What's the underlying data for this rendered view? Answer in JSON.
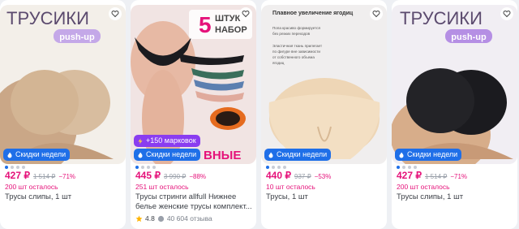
{
  "products": [
    {
      "title_overlay": "ТРУСИКИ",
      "pill": "push-up",
      "badge": "Скидки недели",
      "price": "427 ₽",
      "old_price": "1 514 ₽",
      "discount": "−71%",
      "stock": "200 шт осталось",
      "name": "Трусы слипы, 1 шт"
    },
    {
      "promo_number": "5",
      "promo_word1": "ШТУК",
      "promo_word2": "НАБОР",
      "bottom_text": "ВНЫЕ",
      "carrot_badge": "+150 марковок",
      "badge": "Скидки недели",
      "price": "445 ₽",
      "old_price": "3 990 ₽",
      "discount": "−88%",
      "stock": "251 шт осталось",
      "name": "Трусы стринги allfull Нижнее белье женские трусы комплект...",
      "rating": "4.8",
      "reviews": "40 604 отзыва"
    },
    {
      "heading": "Плавное увеличение ягодиц",
      "line1a": "Попа красиво формируется",
      "line1b": "без резких переходов",
      "line2a": "Эластичная ткань прилегает",
      "line2b": "по фигуре вне зависимости",
      "line2c": "от собственного объема",
      "line2d": "ягодиц",
      "badge": "Скидки недели",
      "price": "440 ₽",
      "old_price": "937 ₽",
      "discount": "−53%",
      "stock": "10 шт осталось",
      "name": "Трусы, 1 шт"
    },
    {
      "title_overlay": "ТРУСИКИ",
      "pill": "push-up",
      "badge": "Скидки недели",
      "price": "427 ₽",
      "old_price": "1 514 ₽",
      "discount": "−71%",
      "stock": "200 шт осталось",
      "name": "Трусы слипы, 1 шт"
    }
  ],
  "colors": {
    "accent": "#e5127a",
    "badge": "#1f6fe8",
    "carrot": "#8a3df0"
  },
  "icons": [
    "heart-icon",
    "fire-icon",
    "lightning-icon",
    "star-icon"
  ]
}
